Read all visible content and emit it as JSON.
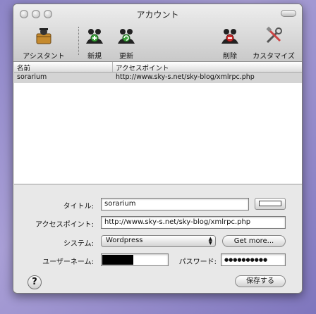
{
  "window": {
    "title": "アカウント"
  },
  "toolbar": {
    "assistant": "アシスタント",
    "new": "新規",
    "update": "更新",
    "delete": "削除",
    "customize": "カスタマイズ"
  },
  "table": {
    "columns": [
      "名前",
      "アクセスポイント"
    ],
    "rows": [
      {
        "name": "sorarium",
        "access_point": "http://www.sky-s.net/sky-blog/xmlrpc.php"
      }
    ]
  },
  "form": {
    "title_label": "タイトル:",
    "title_value": "sorarium",
    "access_label": "アクセスポイント:",
    "access_value": "http://www.sky-s.net/sky-blog/xmlrpc.php",
    "system_label": "システム:",
    "system_value": "Wordpress",
    "get_more": "Get more...",
    "username_label": "ユーザーネーム:",
    "password_label": "パスワード:",
    "password_value": "●●●●●●●●●●",
    "save": "保存する",
    "help": "?"
  },
  "colors": {
    "row_selected": "#d4d4d4",
    "window_bg": "#e8e8e8"
  }
}
